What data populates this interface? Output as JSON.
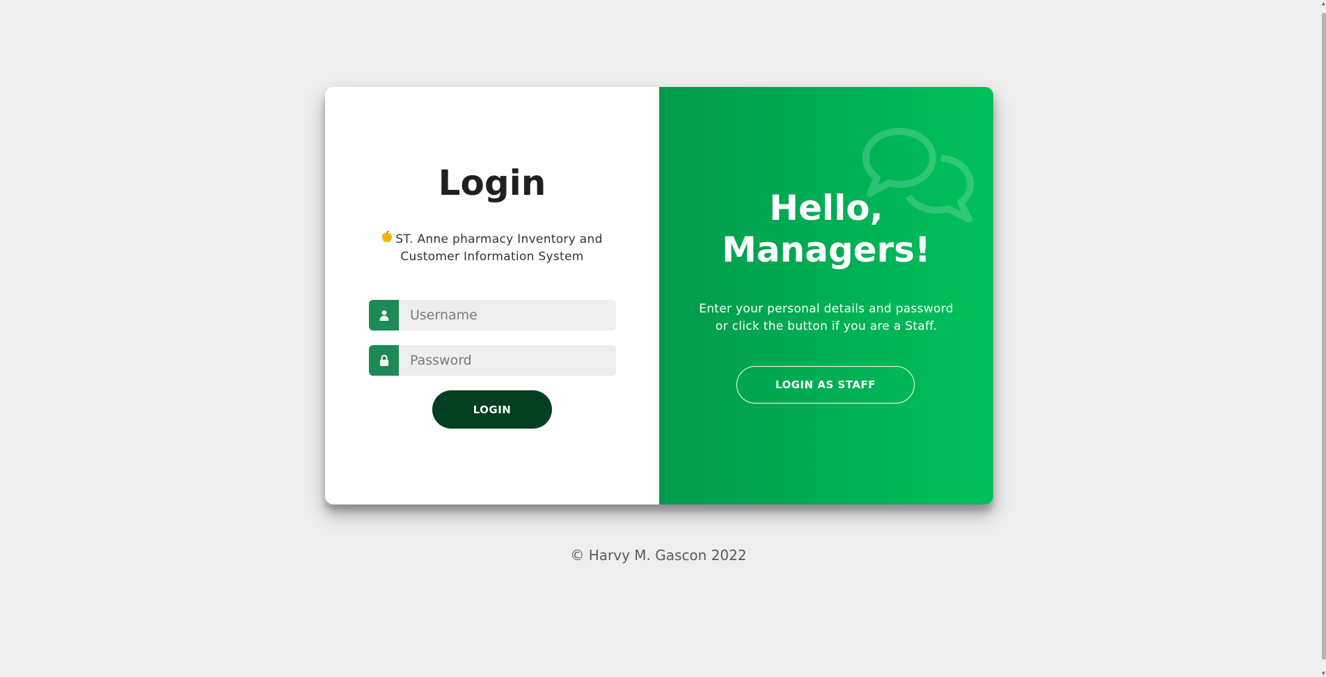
{
  "login_panel": {
    "title": "Login",
    "subtitle": "ST. Anne pharmacy Inventory and Customer Information System",
    "subtitle_icon": "apple-icon",
    "username_placeholder": "Username",
    "username_icon": "user-icon",
    "password_placeholder": "Password",
    "password_icon": "lock-icon",
    "login_button": "LOGIN"
  },
  "overlay_panel": {
    "title": "Hello, Managers!",
    "text": "Enter your personal details and password or click the button if you are a Staff.",
    "button": "LOGIN AS STAFF",
    "icon": "chat-bubbles-icon"
  },
  "footer": {
    "text": "© Harvy M. Gascon 2022"
  },
  "colors": {
    "page_background": "#eeeeee",
    "field_icon_bg": "#1e8a57",
    "login_button_bg": "#033e21",
    "overlay_gradient_start": "#019a4b",
    "overlay_gradient_end": "#00c15c"
  }
}
